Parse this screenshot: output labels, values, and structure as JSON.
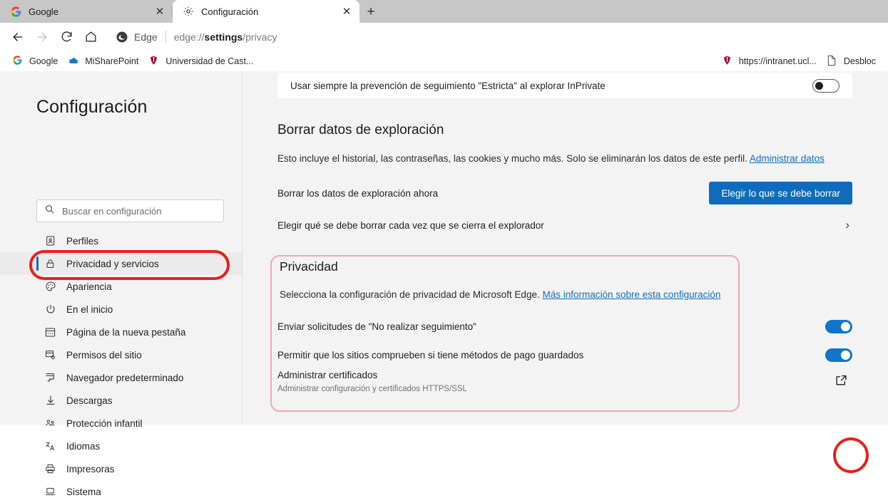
{
  "browser": {
    "tabs": [
      {
        "title": "Google",
        "favicon": "google-icon",
        "active": false
      },
      {
        "title": "Configuración",
        "favicon": "gear-icon",
        "active": true
      }
    ],
    "new_tab_label": "+",
    "close_label": "✕",
    "nav": {
      "back_label": "←",
      "forward_label": "→",
      "reload_label": "⟳",
      "home_label": "⌂"
    },
    "omnibox": {
      "brand": "Edge",
      "url_prefix": "edge://",
      "url_bold": "settings",
      "url_suffix": "/privacy"
    },
    "bookmarks": [
      {
        "label": "Google",
        "icon": "google-icon"
      },
      {
        "label": "MiSharePoint",
        "icon": "cloud-icon"
      },
      {
        "label": "Universidad de Cast...",
        "icon": "uclm-icon"
      }
    ],
    "bookmarks_right": [
      {
        "label": "https://intranet.ucl...",
        "icon": "uclm-icon"
      },
      {
        "label": "Desbloc",
        "icon": "file-icon"
      }
    ]
  },
  "sidebar": {
    "title": "Configuración",
    "search": {
      "placeholder": "Buscar en configuración",
      "icon": "search-icon"
    },
    "items": [
      {
        "label": "Perfiles",
        "icon": "profile-icon",
        "selected": false
      },
      {
        "label": "Privacidad y servicios",
        "icon": "lock-icon",
        "selected": true
      },
      {
        "label": "Apariencia",
        "icon": "palette-icon",
        "selected": false
      },
      {
        "label": "En el inicio",
        "icon": "power-icon",
        "selected": false
      },
      {
        "label": "Página de la nueva pestaña",
        "icon": "newtab-icon",
        "selected": false
      },
      {
        "label": "Permisos del sitio",
        "icon": "site-permissions-icon",
        "selected": false
      },
      {
        "label": "Navegador predeterminado",
        "icon": "default-browser-icon",
        "selected": false
      },
      {
        "label": "Descargas",
        "icon": "download-icon",
        "selected": false
      },
      {
        "label": "Protección infantil",
        "icon": "family-icon",
        "selected": false
      },
      {
        "label": "Idiomas",
        "icon": "language-icon",
        "selected": false
      },
      {
        "label": "Impresoras",
        "icon": "printer-icon",
        "selected": false
      },
      {
        "label": "Sistema",
        "icon": "system-icon",
        "selected": false
      }
    ]
  },
  "main": {
    "inprivate_row": {
      "label": "Usar siempre la prevención de seguimiento \"Estricta\" al explorar InPrivate",
      "toggle_state": "off"
    },
    "clear_section": {
      "heading": "Borrar datos de exploración",
      "description": "Esto incluye el historial, las contraseñas, las cookies y mucho más. Solo se eliminarán los datos de este perfil.",
      "description_link": "Administrar datos",
      "row_now_label": "Borrar los datos de exploración ahora",
      "row_now_button": "Elegir lo que se debe borrar",
      "row_each_label": "Elegir qué se debe borrar cada vez que se cierra el explorador",
      "row_each_chevron": "›"
    },
    "privacy_section": {
      "heading": "Privacidad",
      "description": "Selecciona la configuración de privacidad de Microsoft Edge.",
      "description_link": "Más información sobre esta configuración",
      "rows": [
        {
          "label": "Enviar solicitudes de \"No realizar seguimiento\"",
          "sub": "",
          "control": "toggle",
          "toggle_state": "on"
        },
        {
          "label": "Permitir que los sitios comprueben si tiene métodos de pago guardados",
          "sub": "",
          "control": "toggle",
          "toggle_state": "on"
        },
        {
          "label": "Administrar certificados",
          "sub": "Administrar configuración y certificados HTTPS/SSL",
          "control": "external-link",
          "icon": "external-link-icon"
        }
      ]
    }
  },
  "annotations": {
    "sidebar_highlight_color": "#e8201c",
    "icon_highlight_color": "#e8201c",
    "privacy_box_color": "#f0a8ae"
  },
  "colors": {
    "accent_blue": "#0f6cbd",
    "toggle_on": "#1074c9",
    "page_bg": "#f3f3f3",
    "tabstrip_bg": "#c7c7c7"
  }
}
